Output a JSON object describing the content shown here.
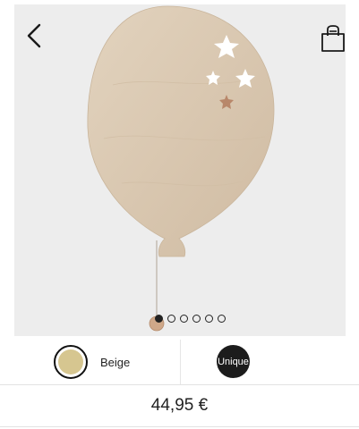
{
  "product": {
    "image_pager": {
      "total": 6,
      "active": 0
    },
    "variants": {
      "color": {
        "label": "Beige",
        "swatch_color": "#d6c690",
        "selected": true
      },
      "size": {
        "label": "Unique"
      }
    },
    "price": "44,95 €"
  },
  "icons": {
    "back": "back-chevron-icon",
    "bag": "shopping-bag-icon"
  },
  "colors": {
    "hero_background": "#ededed",
    "balloon_wood": "#dccbb5",
    "text": "#222222",
    "size_chip": "#1c1c1c"
  }
}
